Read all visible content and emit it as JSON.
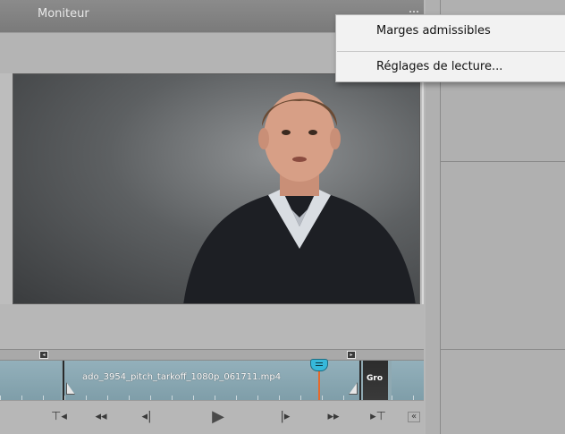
{
  "monitor": {
    "title": "Moniteur"
  },
  "context_menu": {
    "items": [
      {
        "label": "Marges admissibles"
      },
      {
        "label": "Réglages de lecture..."
      }
    ]
  },
  "timeline": {
    "clip_name": "ado_3954_pitch_tarkoff_1080p_061711.mp4",
    "next_clip_name": "Gro",
    "playhead_color": "#36b8da",
    "clip_color": "#8fa9b2"
  },
  "transport": {
    "buttons": [
      {
        "name": "set-in-icon",
        "glyph": "⊤◂"
      },
      {
        "name": "goto-start-icon",
        "glyph": "◂◂"
      },
      {
        "name": "step-back-icon",
        "glyph": "◂|"
      },
      {
        "name": "play-icon",
        "glyph": "▶"
      },
      {
        "name": "step-forward-icon",
        "glyph": "|▸"
      },
      {
        "name": "goto-end-icon",
        "glyph": "▸▸"
      },
      {
        "name": "set-out-icon",
        "glyph": "▸⊤"
      },
      {
        "name": "collapse-icon",
        "glyph": "«"
      }
    ]
  }
}
